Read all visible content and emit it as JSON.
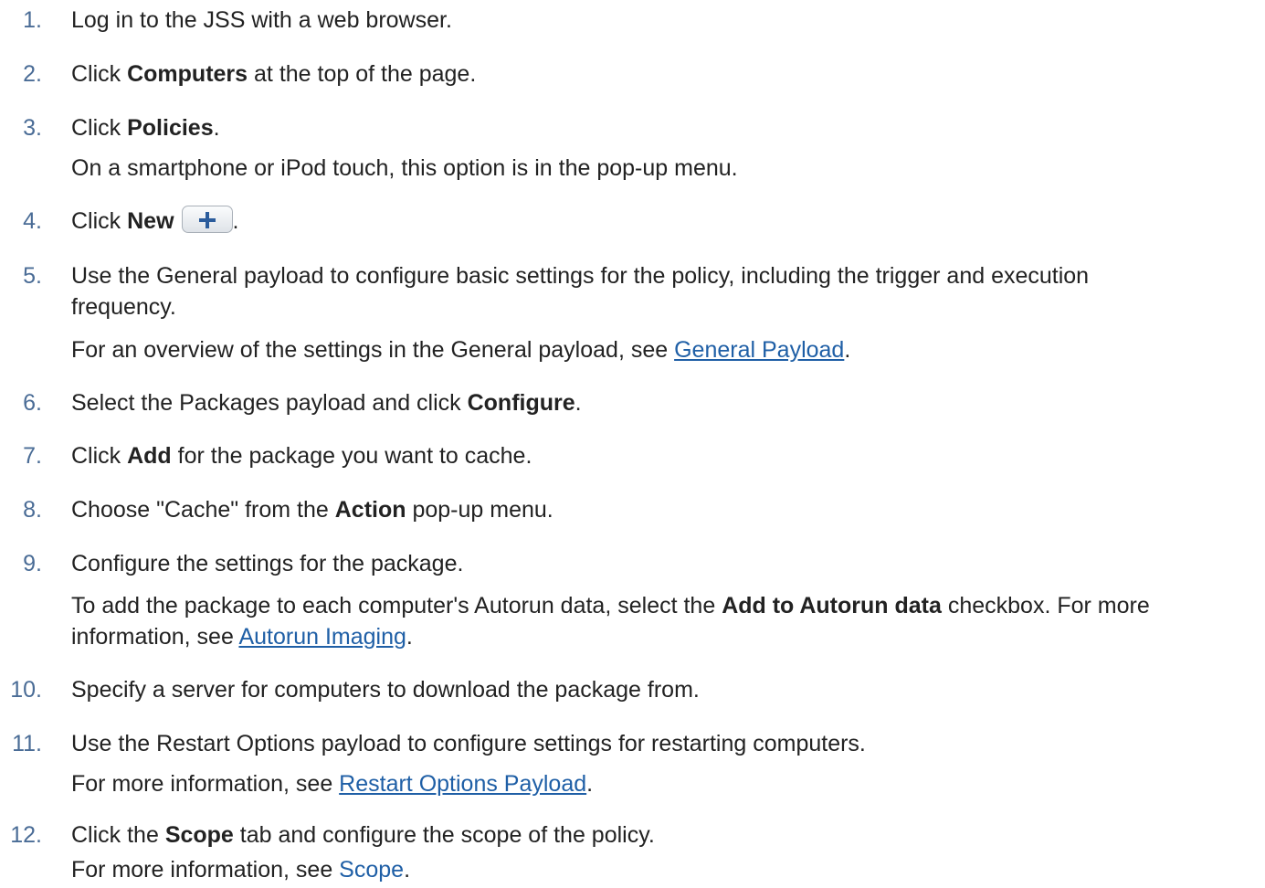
{
  "steps": [
    {
      "number": "1.",
      "text": "Log in to the JSS with a web browser."
    },
    {
      "number": "2.",
      "pre": "Click ",
      "bold": "Computers",
      "post": " at the top of the page."
    },
    {
      "number": "3.",
      "pre": "Click ",
      "bold": "Policies",
      "post": ".",
      "note": "On a smartphone or iPod touch, this option is in the pop-up menu."
    },
    {
      "number": "4.",
      "pre": "Click ",
      "bold": "New",
      "post": ".",
      "button_icon": "plus-icon"
    },
    {
      "number": "5.",
      "line1": "Use the General payload to configure basic settings for the policy, including the trigger and execution",
      "line2": "frequency.",
      "note_pre": "For an overview of the settings in the General payload, see ",
      "note_link": "General Payload",
      "note_post": "."
    },
    {
      "number": "6.",
      "pre": "Select the Packages payload and click ",
      "bold": "Configure",
      "post": "."
    },
    {
      "number": "7.",
      "pre": "Click ",
      "bold": "Add",
      "post": " for the package you want to cache."
    },
    {
      "number": "8.",
      "pre": "Choose \"Cache\" from the ",
      "bold": "Action",
      "post": " pop-up menu."
    },
    {
      "number": "9.",
      "text": "Configure the settings for the package.",
      "note_pre": "To add the package to each computer's Autorun data, select the ",
      "note_bold": "Add to Autorun data",
      "note_mid": " checkbox. For more",
      "note_line2_pre": "information, see ",
      "note_link": "Autorun Imaging",
      "note_post": "."
    },
    {
      "number": "10.",
      "text": "Specify a server for computers to download the package from."
    },
    {
      "number": "11.",
      "text": "Use the Restart Options payload to configure settings for restarting computers.",
      "note_pre": "For more information, see ",
      "note_link": "Restart Options Payload",
      "note_post": "."
    },
    {
      "number": "12.",
      "pre": "Click the ",
      "bold": "Scope",
      "post": " tab and configure the scope of the policy.",
      "note_pre": "For more information, see ",
      "note_link": "Scope",
      "note_post": "."
    }
  ],
  "colors": {
    "number": "#4a6c96",
    "text": "#222222",
    "link": "#1f5fa6",
    "button_border": "#a9b0b8",
    "plus_icon": "#2b5c9c"
  }
}
